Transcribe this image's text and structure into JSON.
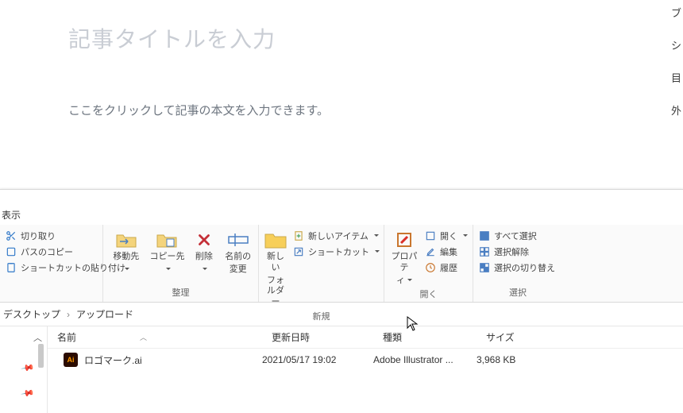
{
  "editor": {
    "title_placeholder": "記事タイトルを入力",
    "body_placeholder": "ここをクリックして記事の本文を入力できます。"
  },
  "side_links": [
    "ブ",
    "シ",
    "目",
    "外"
  ],
  "tab": "表示",
  "ribbon": {
    "clipboard": {
      "cut": "切り取り",
      "copy_path": "パスのコピー",
      "paste_shortcut": "ショートカットの貼り付け"
    },
    "organize": {
      "move_to": "移動先",
      "copy_to": "コピー先",
      "delete": "削除",
      "rename_l1": "名前の",
      "rename_l2": "変更",
      "label": "整理"
    },
    "new": {
      "new_folder_l1": "新しい",
      "new_folder_l2": "フォルダー",
      "new_item": "新しいアイテム",
      "shortcut": "ショートカット",
      "label": "新規"
    },
    "open": {
      "properties_l1": "プロパテ",
      "properties_l2": "ィ",
      "open_cmd": "開く",
      "edit_cmd": "編集",
      "history": "履歴",
      "label": "開く"
    },
    "select": {
      "select_all": "すべて選択",
      "select_none": "選択解除",
      "invert": "選択の切り替え",
      "label": "選択"
    }
  },
  "breadcrumb": {
    "a": "デスクトップ",
    "b": "アップロード"
  },
  "columns": {
    "name": "名前",
    "date": "更新日時",
    "type": "種類",
    "size": "サイズ"
  },
  "file": {
    "icon_text": "Ai",
    "name": "ロゴマーク.ai",
    "date": "2021/05/17 19:02",
    "type": "Adobe Illustrator ...",
    "size": "3,968 KB"
  }
}
